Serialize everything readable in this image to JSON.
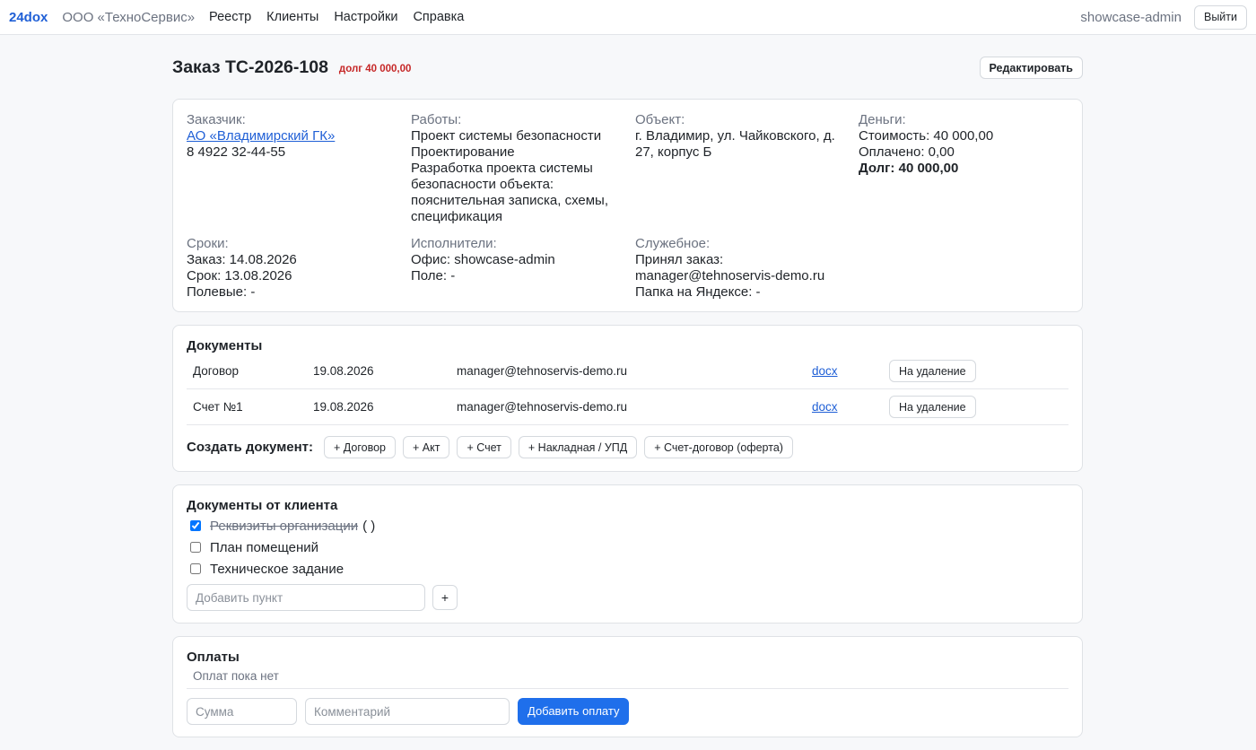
{
  "nav": {
    "brand": "24dox",
    "org": "ООО «ТехноСервис»",
    "links": [
      "Реестр",
      "Клиенты",
      "Настройки",
      "Справка"
    ],
    "username": "showcase-admin",
    "logout_label": "Выйти"
  },
  "order": {
    "title": "Заказ ТС-2026-108",
    "debt_badge": "долг 40 000,00",
    "edit_label": "Редактировать"
  },
  "info": {
    "customer_label": "Заказчик:",
    "customer_name": "АО «Владимирский ГК»",
    "customer_phone": "8 4922 32-44-55",
    "works_label": "Работы:",
    "works_title": "Проект системы безопасности",
    "works_type": "Проектирование",
    "works_desc": "Разработка проекта системы безопасности объекта: пояснительная записка, схемы, спецификация",
    "object_label": "Объект:",
    "object_address": "г. Владимир, ул. Чайковского, д. 27, корпус Б",
    "money_label": "Деньги:",
    "money_cost": "Стоимость: 40 000,00",
    "money_paid": "Оплачено: 0,00",
    "money_debt": "Долг: 40 000,00",
    "terms_label": "Сроки:",
    "terms_order": "Заказ: 14.08.2026",
    "terms_due": "Срок: 13.08.2026",
    "terms_field": "Полевые: -",
    "exec_label": "Исполнители:",
    "exec_office": "Офис: showcase-admin",
    "exec_field": "Поле: -",
    "service_label": "Служебное:",
    "service_accepted": "Принял заказ:",
    "service_email": "manager@tehnoservis-demo.ru",
    "service_folder": "Папка на Яндексе: -"
  },
  "documents": {
    "title": "Документы",
    "rows": [
      {
        "name": "Договор",
        "date": "19.08.2026",
        "author": "manager@tehnoservis-demo.ru",
        "format": "docx",
        "action": "На удаление"
      },
      {
        "name": "Счет №1",
        "date": "19.08.2026",
        "author": "manager@tehnoservis-demo.ru",
        "format": "docx",
        "action": "На удаление"
      }
    ],
    "create_label": "Создать документ:",
    "create_buttons": [
      "+ Договор",
      "+ Акт",
      "+ Счет",
      "+ Накладная / УПД",
      "+ Счет-договор (оферта)"
    ]
  },
  "client_docs": {
    "title": "Документы от клиента",
    "items": [
      {
        "label": "Реквизиты организации",
        "suffix": "( )",
        "checked": true
      },
      {
        "label": "План помещений",
        "suffix": "",
        "checked": false
      },
      {
        "label": "Техническое задание",
        "suffix": "",
        "checked": false
      }
    ],
    "add_placeholder": "Добавить пункт",
    "add_button": "+"
  },
  "payments": {
    "title": "Оплаты",
    "empty_text": "Оплат пока нет",
    "amount_placeholder": "Сумма",
    "comment_placeholder": "Комментарий",
    "add_label": "Добавить оплату"
  },
  "colors": {
    "accent": "#1f6feb",
    "link": "#1f5fd6",
    "debt": "#c62828"
  }
}
